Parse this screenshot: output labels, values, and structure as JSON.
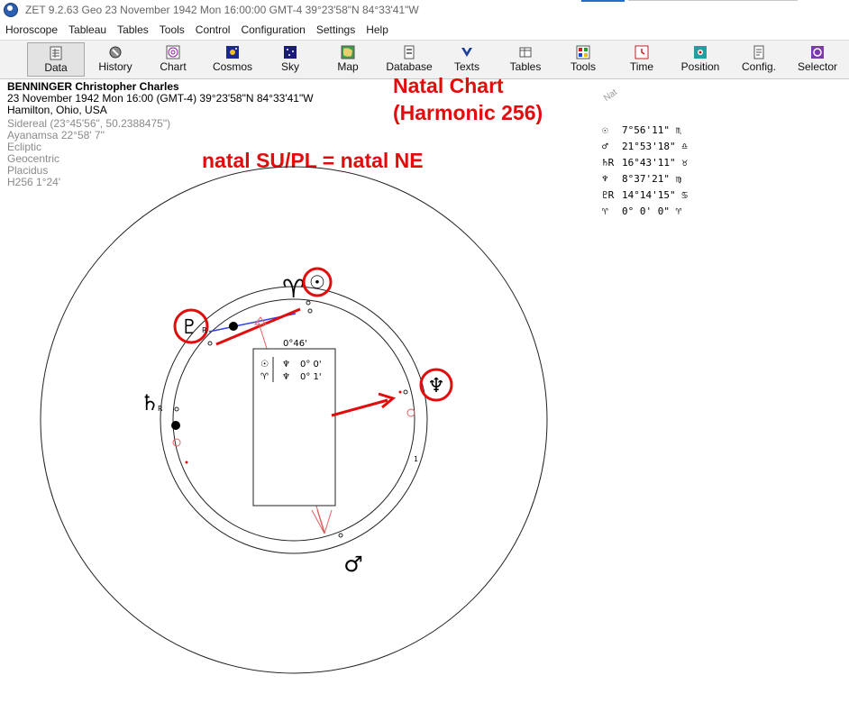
{
  "titlebar": {
    "title": "ZET 9.2.63 Geo   23 November 1942  Mon  16:00:00 GMT-4 39°23'58\"N  84°33'41\"W"
  },
  "menu": [
    "Horoscope",
    "Tableau",
    "Tables",
    "Tools",
    "Control",
    "Configuration",
    "Settings",
    "Help"
  ],
  "toolbar": [
    {
      "label": "Data",
      "icon": "data-icon"
    },
    {
      "label": "History",
      "icon": "history-icon"
    },
    {
      "label": "Chart",
      "icon": "chart-icon"
    },
    {
      "label": "Cosmos",
      "icon": "cosmos-icon"
    },
    {
      "label": "Sky",
      "icon": "sky-icon"
    },
    {
      "label": "Map",
      "icon": "map-icon"
    },
    {
      "label": "Database",
      "icon": "database-icon"
    },
    {
      "label": "Texts",
      "icon": "texts-icon"
    },
    {
      "label": "Tables",
      "icon": "tables-icon"
    },
    {
      "label": "Tools",
      "icon": "tools-icon"
    },
    {
      "label": "Time",
      "icon": "time-icon"
    },
    {
      "label": "Position",
      "icon": "position-icon"
    },
    {
      "label": "Config.",
      "icon": "config-icon"
    },
    {
      "label": "Selector",
      "icon": "selector-icon"
    }
  ],
  "info": {
    "name": "BENNINGER Christopher Charles",
    "datetime": "23 November 1942  Mon  16:00 (GMT-4) 39°23'58\"N  84°33'41\"W",
    "place": "Hamilton, Ohio, USA",
    "sidereal": "Sidereal (23°45'56\", 50.2388475\")",
    "ayanamsa": "Ayanamsa 22°58' 7\"",
    "coord1": "Ecliptic",
    "coord2": "Geocentric",
    "house": "Placidus",
    "harmonic": "H256   1°24'"
  },
  "annotations": {
    "title1": "Natal Chart",
    "title2": "(Harmonic 256)",
    "midpoint": "natal SU/PL = natal NE"
  },
  "legend": {
    "title": "Nat",
    "rows": [
      {
        "glyph": "☉",
        "value": "7°56'11\" ♏"
      },
      {
        "glyph": "♂",
        "value": "21°53'18\" ♎"
      },
      {
        "glyph": "♄R",
        "value": "16°43'11\" ♉"
      },
      {
        "glyph": "♆",
        "value": "8°37'21\" ♍"
      },
      {
        "glyph": "♇R",
        "value": "14°14'15\" ♋"
      },
      {
        "glyph": "♈",
        "value": "0° 0' 0\" ♈"
      }
    ]
  },
  "wheel": {
    "orb": "0°46'",
    "aspects": [
      {
        "p1": "☉",
        "p2": "♆",
        "value": "0° 0'"
      },
      {
        "p1": "♈",
        "p2": "♆",
        "value": "0° 1'"
      }
    ],
    "glyphs": {
      "aries": "♈",
      "sun": "☉",
      "pluto": "♇",
      "neptune": "♆",
      "saturn": "♄",
      "mars": "♂",
      "retro": "R",
      "tick1": "1"
    }
  },
  "colors": {
    "annotation": "#e10c0c",
    "accent_blue": "#1e70c8"
  }
}
